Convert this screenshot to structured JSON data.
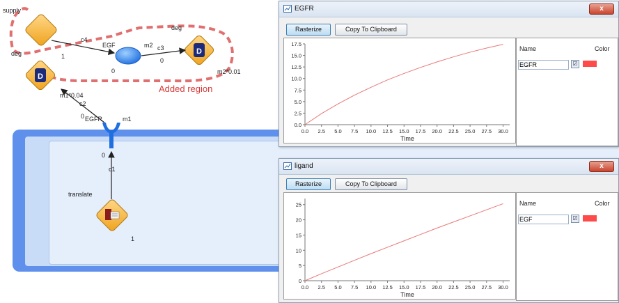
{
  "diagram": {
    "nodes": {
      "supply": "supply",
      "deg_top": "deg",
      "deg_left": "deg",
      "translate": "translate"
    },
    "edges": {
      "c4": "c4",
      "c3": "c3",
      "c2": "c2",
      "c1": "c1"
    },
    "species": {
      "egf": "EGF",
      "egfr": "EGFR",
      "m2": "m2",
      "m1": "m1"
    },
    "values": {
      "one_supply": "1",
      "zero_egf": "0",
      "zero_c3": "0",
      "rate_deg": "m2*0.01",
      "rate_c2": "m1*0.04",
      "zero_egfr": "0",
      "zero_m1": "0",
      "one_translate": "1"
    },
    "annotation": "Added region",
    "region_color": "#e07070",
    "compartment_color": "#6f9cf0"
  },
  "egfr_window": {
    "title": "EGFR",
    "buttons": {
      "rasterize": "Rasterize",
      "copy": "Copy To Clipboard"
    },
    "close_label": "x",
    "legend": {
      "name_header": "Name",
      "color_header": "Color",
      "rows": [
        {
          "name": "EGFR",
          "checked": "☑",
          "color": "#ff4a4a"
        }
      ]
    },
    "chart_data": {
      "type": "line",
      "xlabel": "Time",
      "ylabel": "",
      "xlim": [
        0,
        31
      ],
      "ylim": [
        0,
        17.5
      ],
      "xticks": [
        "0.0",
        "2.5",
        "5.0",
        "7.5",
        "10.0",
        "12.5",
        "15.0",
        "17.5",
        "20.0",
        "22.5",
        "25.0",
        "27.5",
        "30.0"
      ],
      "yticks": [
        "0.0",
        "2.5",
        "5.0",
        "7.5",
        "10.0",
        "12.5",
        "15.0",
        "17.5"
      ],
      "series": [
        {
          "name": "EGFR",
          "color": "#e87878",
          "x": [
            0,
            2.5,
            5,
            7.5,
            10,
            12.5,
            15,
            17.5,
            20,
            22.5,
            25,
            27.5,
            30
          ],
          "y": [
            0,
            2.4,
            4.5,
            6.4,
            8.1,
            9.7,
            11.1,
            12.4,
            13.6,
            14.7,
            15.7,
            16.6,
            17.4
          ]
        }
      ]
    }
  },
  "ligand_window": {
    "title": "ligand",
    "buttons": {
      "rasterize": "Rasterize",
      "copy": "Copy To Clipboard"
    },
    "close_label": "x",
    "legend": {
      "name_header": "Name",
      "color_header": "Color",
      "rows": [
        {
          "name": "EGF",
          "checked": "☑",
          "color": "#ff4a4a"
        }
      ]
    },
    "chart_data": {
      "type": "line",
      "xlabel": "Time",
      "ylabel": "",
      "xlim": [
        0,
        31
      ],
      "ylim": [
        0,
        27
      ],
      "xticks": [
        "0.0",
        "2.5",
        "5.0",
        "7.5",
        "10.0",
        "12.5",
        "15.0",
        "17.5",
        "20.0",
        "22.5",
        "25.0",
        "27.5",
        "30.0"
      ],
      "yticks": [
        "0",
        "5",
        "10",
        "15",
        "20",
        "25"
      ],
      "series": [
        {
          "name": "EGF",
          "color": "#e87878",
          "x": [
            0,
            2.5,
            5,
            7.5,
            10,
            12.5,
            15,
            17.5,
            20,
            22.5,
            25,
            27.5,
            30
          ],
          "y": [
            0,
            2.3,
            4.5,
            6.7,
            8.9,
            11.0,
            13.1,
            15.2,
            17.3,
            19.3,
            21.3,
            23.3,
            25.3
          ]
        }
      ]
    }
  }
}
